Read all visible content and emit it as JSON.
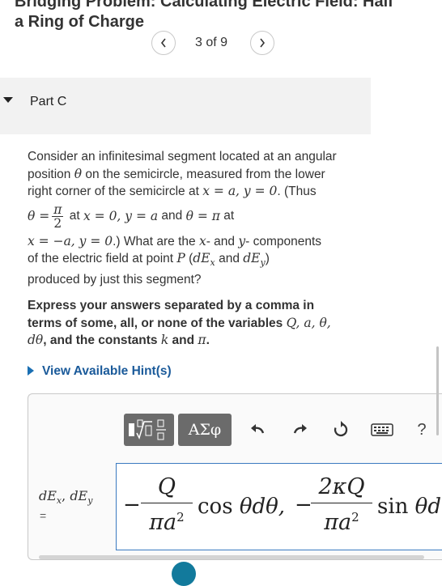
{
  "header": {
    "title_line1": "Bridging Problem: Calculating Electric Field: Half",
    "title_line2": "a Ring of Charge",
    "nav": {
      "prev_icon": "chevron-left-icon",
      "next_icon": "chevron-right-icon",
      "count": "3 of 9"
    }
  },
  "part": {
    "label": "Part C",
    "caret_icon": "caret-down-icon"
  },
  "question": {
    "line1": "Consider an infinitesimal segment located at an angular",
    "line2_pre": "position ",
    "line2_post": " on the semicircle, measured from the lower",
    "line3_pre": "right corner of the semicircle at ",
    "line3_math": "x = a, y = 0",
    "line3_post": ". (Thus",
    "line4_theta": "θ =",
    "line4_num": "π",
    "line4_den": "2",
    "line4_at": " at ",
    "line4_math1": "x = 0, y = a",
    "line4_and": " and ",
    "line4_math2": "θ = π",
    "line4_at2": " at",
    "line5_math": "x = −a, y = 0",
    "line5_post": ".) What are the ",
    "line5_x": "x",
    "line5_mid": "- and ",
    "line5_y": "y",
    "line5_end": "- components",
    "line6_pre": "of the electric field at point ",
    "line6_P": "P",
    "line6_paren": " (",
    "line6_dEx": "dE",
    "line6_xsub": "x",
    "line6_and": " and ",
    "line6_dEy": "dE",
    "line6_ysub": "y",
    "line6_close": ")",
    "line7": "produced by just this segment?",
    "theta": "θ"
  },
  "instruction": {
    "line1": "Express your answers separated by a comma in",
    "line2_pre": "terms of some, all, or none of the variables ",
    "line2_vars": "Q, a, θ,",
    "line3_dtheta": "dθ",
    "line3_mid": ", and the constants ",
    "line3_k": "k",
    "line3_and": " and ",
    "line3_pi": "π",
    "line3_end": "."
  },
  "hints": {
    "label": "View Available Hint(s)",
    "icon": "triangle-right-icon"
  },
  "toolbar": {
    "templates_icon": "math-templates-icon",
    "greek_label": "ΑΣφ",
    "undo_icon": "undo-icon",
    "redo_icon": "redo-icon",
    "reset_icon": "reset-icon",
    "keyboard_icon": "keyboard-icon",
    "help_label": "?"
  },
  "answer": {
    "var_label_1": "dE",
    "var_sub_1": "x",
    "var_comma": ", ",
    "var_label_2": "dE",
    "var_sub_2": "y",
    "eq": "=",
    "minus1": "−",
    "frac1_num": "Q",
    "frac1_den": "πa",
    "frac1_exp": "2",
    "term1": "cos θdθ,",
    "minus2": "−",
    "frac2_num": "2κQ",
    "frac2_den": "πa",
    "frac2_exp": "2",
    "term2": "sin θd"
  }
}
